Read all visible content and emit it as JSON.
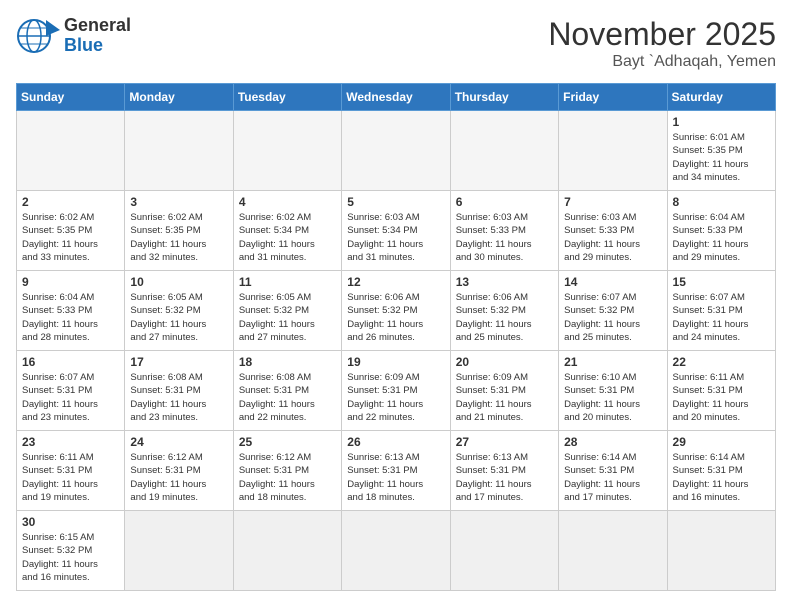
{
  "header": {
    "title": "November 2025",
    "subtitle": "Bayt `Adhaqah, Yemen",
    "logo_general": "General",
    "logo_blue": "Blue"
  },
  "days_of_week": [
    "Sunday",
    "Monday",
    "Tuesday",
    "Wednesday",
    "Thursday",
    "Friday",
    "Saturday"
  ],
  "weeks": [
    [
      {
        "day": "",
        "info": ""
      },
      {
        "day": "",
        "info": ""
      },
      {
        "day": "",
        "info": ""
      },
      {
        "day": "",
        "info": ""
      },
      {
        "day": "",
        "info": ""
      },
      {
        "day": "",
        "info": ""
      },
      {
        "day": "1",
        "info": "Sunrise: 6:01 AM\nSunset: 5:35 PM\nDaylight: 11 hours\nand 34 minutes."
      }
    ],
    [
      {
        "day": "2",
        "info": "Sunrise: 6:02 AM\nSunset: 5:35 PM\nDaylight: 11 hours\nand 33 minutes."
      },
      {
        "day": "3",
        "info": "Sunrise: 6:02 AM\nSunset: 5:35 PM\nDaylight: 11 hours\nand 32 minutes."
      },
      {
        "day": "4",
        "info": "Sunrise: 6:02 AM\nSunset: 5:34 PM\nDaylight: 11 hours\nand 31 minutes."
      },
      {
        "day": "5",
        "info": "Sunrise: 6:03 AM\nSunset: 5:34 PM\nDaylight: 11 hours\nand 31 minutes."
      },
      {
        "day": "6",
        "info": "Sunrise: 6:03 AM\nSunset: 5:33 PM\nDaylight: 11 hours\nand 30 minutes."
      },
      {
        "day": "7",
        "info": "Sunrise: 6:03 AM\nSunset: 5:33 PM\nDaylight: 11 hours\nand 29 minutes."
      },
      {
        "day": "8",
        "info": "Sunrise: 6:04 AM\nSunset: 5:33 PM\nDaylight: 11 hours\nand 29 minutes."
      }
    ],
    [
      {
        "day": "9",
        "info": "Sunrise: 6:04 AM\nSunset: 5:33 PM\nDaylight: 11 hours\nand 28 minutes."
      },
      {
        "day": "10",
        "info": "Sunrise: 6:05 AM\nSunset: 5:32 PM\nDaylight: 11 hours\nand 27 minutes."
      },
      {
        "day": "11",
        "info": "Sunrise: 6:05 AM\nSunset: 5:32 PM\nDaylight: 11 hours\nand 27 minutes."
      },
      {
        "day": "12",
        "info": "Sunrise: 6:06 AM\nSunset: 5:32 PM\nDaylight: 11 hours\nand 26 minutes."
      },
      {
        "day": "13",
        "info": "Sunrise: 6:06 AM\nSunset: 5:32 PM\nDaylight: 11 hours\nand 25 minutes."
      },
      {
        "day": "14",
        "info": "Sunrise: 6:07 AM\nSunset: 5:32 PM\nDaylight: 11 hours\nand 25 minutes."
      },
      {
        "day": "15",
        "info": "Sunrise: 6:07 AM\nSunset: 5:31 PM\nDaylight: 11 hours\nand 24 minutes."
      }
    ],
    [
      {
        "day": "16",
        "info": "Sunrise: 6:07 AM\nSunset: 5:31 PM\nDaylight: 11 hours\nand 23 minutes."
      },
      {
        "day": "17",
        "info": "Sunrise: 6:08 AM\nSunset: 5:31 PM\nDaylight: 11 hours\nand 23 minutes."
      },
      {
        "day": "18",
        "info": "Sunrise: 6:08 AM\nSunset: 5:31 PM\nDaylight: 11 hours\nand 22 minutes."
      },
      {
        "day": "19",
        "info": "Sunrise: 6:09 AM\nSunset: 5:31 PM\nDaylight: 11 hours\nand 22 minutes."
      },
      {
        "day": "20",
        "info": "Sunrise: 6:09 AM\nSunset: 5:31 PM\nDaylight: 11 hours\nand 21 minutes."
      },
      {
        "day": "21",
        "info": "Sunrise: 6:10 AM\nSunset: 5:31 PM\nDaylight: 11 hours\nand 20 minutes."
      },
      {
        "day": "22",
        "info": "Sunrise: 6:11 AM\nSunset: 5:31 PM\nDaylight: 11 hours\nand 20 minutes."
      }
    ],
    [
      {
        "day": "23",
        "info": "Sunrise: 6:11 AM\nSunset: 5:31 PM\nDaylight: 11 hours\nand 19 minutes."
      },
      {
        "day": "24",
        "info": "Sunrise: 6:12 AM\nSunset: 5:31 PM\nDaylight: 11 hours\nand 19 minutes."
      },
      {
        "day": "25",
        "info": "Sunrise: 6:12 AM\nSunset: 5:31 PM\nDaylight: 11 hours\nand 18 minutes."
      },
      {
        "day": "26",
        "info": "Sunrise: 6:13 AM\nSunset: 5:31 PM\nDaylight: 11 hours\nand 18 minutes."
      },
      {
        "day": "27",
        "info": "Sunrise: 6:13 AM\nSunset: 5:31 PM\nDaylight: 11 hours\nand 17 minutes."
      },
      {
        "day": "28",
        "info": "Sunrise: 6:14 AM\nSunset: 5:31 PM\nDaylight: 11 hours\nand 17 minutes."
      },
      {
        "day": "29",
        "info": "Sunrise: 6:14 AM\nSunset: 5:31 PM\nDaylight: 11 hours\nand 16 minutes."
      }
    ],
    [
      {
        "day": "30",
        "info": "Sunrise: 6:15 AM\nSunset: 5:32 PM\nDaylight: 11 hours\nand 16 minutes."
      },
      {
        "day": "",
        "info": ""
      },
      {
        "day": "",
        "info": ""
      },
      {
        "day": "",
        "info": ""
      },
      {
        "day": "",
        "info": ""
      },
      {
        "day": "",
        "info": ""
      },
      {
        "day": "",
        "info": ""
      }
    ]
  ]
}
